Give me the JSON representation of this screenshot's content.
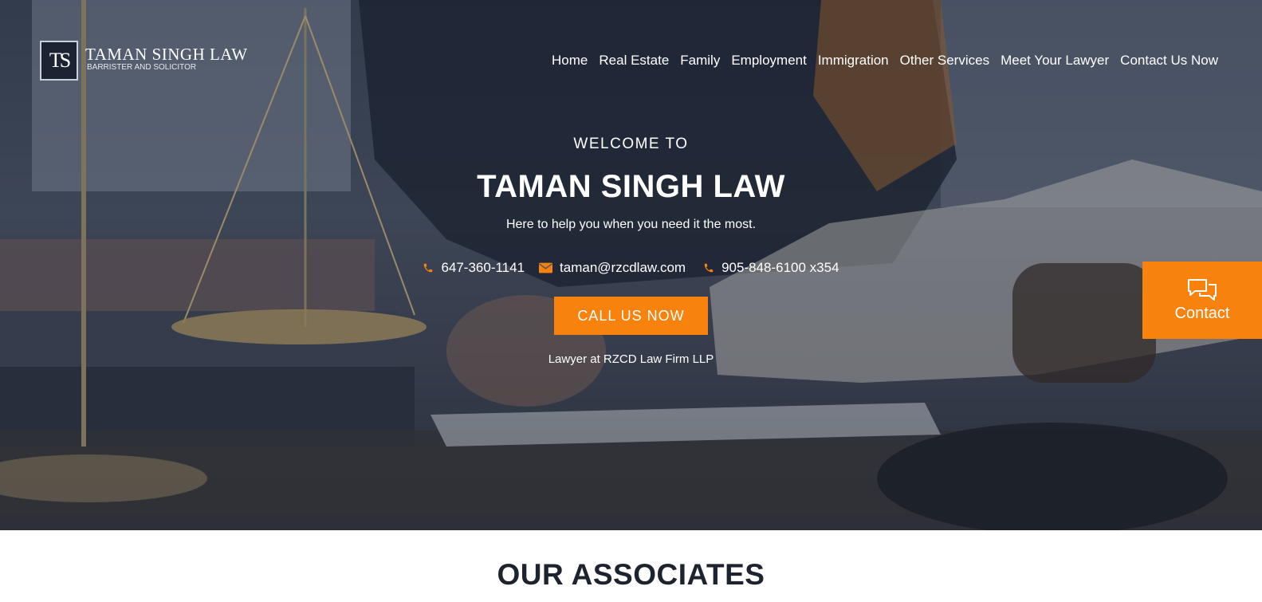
{
  "logo": {
    "monogram": "TS",
    "name": "TAMAN SINGH LAW",
    "subtitle": "BARRISTER AND SOLICITOR"
  },
  "nav": {
    "items": [
      {
        "label": "Home"
      },
      {
        "label": "Real Estate"
      },
      {
        "label": "Family"
      },
      {
        "label": "Employment"
      },
      {
        "label": "Immigration"
      },
      {
        "label": "Other Services"
      },
      {
        "label": "Meet Your Lawyer"
      },
      {
        "label": "Contact Us Now"
      }
    ]
  },
  "hero": {
    "welcome": "WELCOME TO",
    "title": "TAMAN SINGH LAW",
    "tagline": "Here to help you when you need it the most.",
    "contacts": [
      {
        "icon": "phone-icon",
        "text": "647-360-1141"
      },
      {
        "icon": "envelope-icon",
        "text": "taman@rzcdlaw.com"
      },
      {
        "icon": "phone-icon",
        "text": "905-848-6100 x354"
      }
    ],
    "cta_label": "CALL US NOW",
    "firm": "Lawyer at RZCD Law Firm LLP"
  },
  "floating_contact": {
    "icon": "chat-bubbles-icon",
    "label": "Contact"
  },
  "section": {
    "title": "OUR ASSOCIATES"
  },
  "colors": {
    "accent": "#f7820d",
    "heading": "#1e2330"
  }
}
